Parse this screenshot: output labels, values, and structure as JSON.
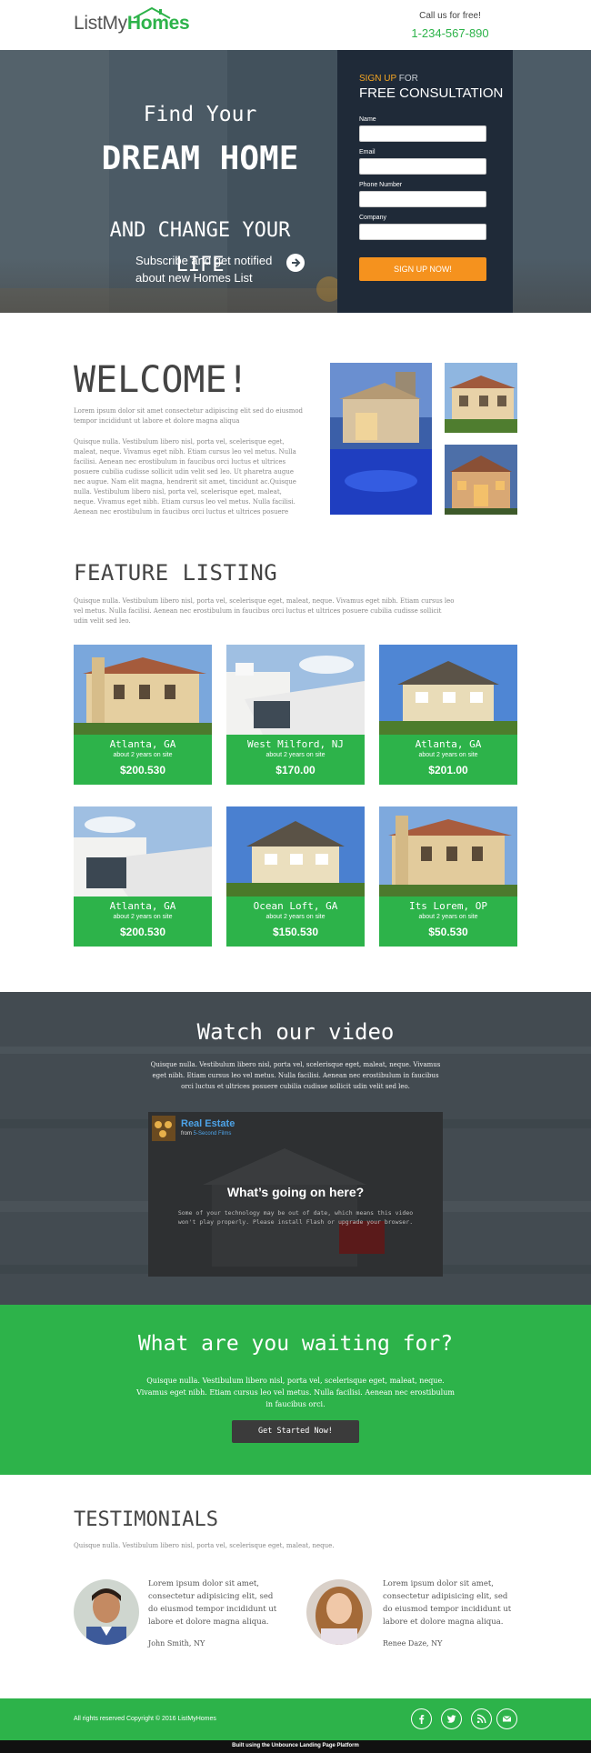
{
  "header": {
    "logo_regular": "ListMy",
    "logo_bold": "Homes",
    "call_text": "Call us for free!",
    "phone": "1-234-567-890"
  },
  "hero": {
    "line1": "Find Your",
    "line2": "DREAM HOME",
    "line3": "AND CHANGE YOUR LIFE",
    "subscribe": "Subscribe and get notified about new Homes List"
  },
  "form": {
    "kicker_accent": "SIGN UP",
    "kicker_rest": " FOR",
    "title": "FREE CONSULTATION",
    "fields": [
      {
        "label": "Name",
        "value": ""
      },
      {
        "label": "Email",
        "value": ""
      },
      {
        "label": "Phone Number",
        "value": ""
      },
      {
        "label": "Company",
        "value": ""
      }
    ],
    "submit": "SIGN UP NOW!"
  },
  "welcome": {
    "title": "WELCOME!",
    "intro": "Lorem ipsum dolor sit amet consectetur adipiscing elit sed do eiusmod tempor incididunt ut labore et dolore magna aliqua",
    "body": "Quisque nulla. Vestibulum libero nisl, porta vel, scelerisque eget, maleat, neque. Vivamus eget nibh. Etiam cursus leo vel metus. Nulla facilisi. Aenean nec erostibulum in faucibus orci luctus et ultrices posuere cubilia cudisse sollicit udin velit sed leo. Ut pharetra augue nec augue. Nam elit magna, hendrerit sit amet, tincidunt ac.Quisque nulla. Vestibulum libero nisl, porta vel, scelerisque eget, maleat, neque. Vivamus eget nibh. Etiam cursus leo vel metus. Nulla facilisi. Aenean nec erostibulum in faucibus orci luctus et ultrices posuere"
  },
  "features": {
    "title": "FEATURE LISTING",
    "desc": "Quisque nulla. Vestibulum libero nisl, porta vel, scelerisque eget, maleat, neque. Vivamus eget nibh. Etiam cursus leo vel metus. Nulla facilisi. Aenean nec erostibulum in faucibus orci luctus et ultrices posuere cubilia cudisse sollicit udin velit sed leo.",
    "listings": [
      {
        "city": "Atlanta, GA",
        "ago": "about 2 years on site",
        "price": "$200.530"
      },
      {
        "city": "West Milford, NJ",
        "ago": "about 2 years on site",
        "price": "$170.00"
      },
      {
        "city": "Atlanta, GA",
        "ago": "about 2 years on site",
        "price": "$201.00"
      },
      {
        "city": "Atlanta, GA",
        "ago": "about 2 years on site",
        "price": "$200.530"
      },
      {
        "city": "Ocean Loft, GA",
        "ago": "about 2 years on site",
        "price": "$150.530"
      },
      {
        "city": "Its Lorem, OP",
        "ago": "about 2 years on site",
        "price": "$50.530"
      }
    ]
  },
  "video": {
    "title": "Watch our video",
    "desc": "Quisque nulla. Vestibulum libero nisl, porta vel, scelerisque eget, maleat, neque. Vivamus eget nibh. Etiam cursus leo vel metus. Nulla facilisi. Aenean nec erostibulum in faucibus orci luctus et ultrices posuere cubilia cudisse sollicit udin velit sed leo.",
    "player_title": "Real Estate",
    "player_from": "from ",
    "player_from_link": "5-Second Films",
    "player_heading": "What’s going on here?",
    "player_msg": "Some of your technology may be out of date, which means this video won't play properly. Please install Flash or upgrade your browser."
  },
  "cta": {
    "title": "What are you waiting for?",
    "desc": "Quisque nulla. Vestibulum libero nisl, porta vel, scelerisque eget, maleat, neque. Vivamus eget nibh. Etiam cursus leo vel metus. Nulla facilisi. Aenean nec erostibulum in faucibus orci.",
    "button": "Get Started Now!"
  },
  "testimonials": {
    "title": "TESTIMONIALS",
    "desc": "Quisque nulla. Vestibulum libero nisl, porta vel, scelerisque eget, maleat, neque.",
    "items": [
      {
        "quote": "Lorem ipsum dolor sit amet, consectetur adipisicing elit, sed do eiusmod tempor incididunt ut labore et dolore magna aliqua.",
        "name": "John Smith, NY"
      },
      {
        "quote": "Lorem ipsum dolor sit amet, consectetur adipisicing elit, sed do eiusmod tempor incididunt ut labore et dolore magna aliqua.",
        "name": "Renee Daze, NY"
      }
    ]
  },
  "footer": {
    "copyright": "All rights reserved Copyright © 2016 ListMyHomes",
    "social_icons": [
      "facebook-icon",
      "twitter-icon",
      "rss-icon",
      "email-icon"
    ],
    "built_with": "Built using the Unbounce Landing Page Platform"
  },
  "colors": {
    "brand_green": "#2db34a",
    "form_navy": "#1f2a38",
    "signup_orange": "#f5921e"
  }
}
